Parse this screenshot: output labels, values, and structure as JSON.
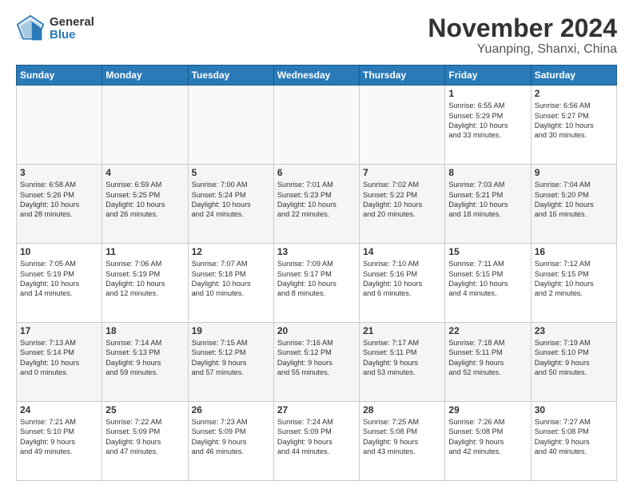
{
  "header": {
    "logo_general": "General",
    "logo_blue": "Blue",
    "title": "November 2024",
    "subtitle": "Yuanping, Shanxi, China"
  },
  "weekdays": [
    "Sunday",
    "Monday",
    "Tuesday",
    "Wednesday",
    "Thursday",
    "Friday",
    "Saturday"
  ],
  "weeks": [
    [
      {
        "day": "",
        "info": ""
      },
      {
        "day": "",
        "info": ""
      },
      {
        "day": "",
        "info": ""
      },
      {
        "day": "",
        "info": ""
      },
      {
        "day": "",
        "info": ""
      },
      {
        "day": "1",
        "info": "Sunrise: 6:55 AM\nSunset: 5:29 PM\nDaylight: 10 hours\nand 33 minutes."
      },
      {
        "day": "2",
        "info": "Sunrise: 6:56 AM\nSunset: 5:27 PM\nDaylight: 10 hours\nand 30 minutes."
      }
    ],
    [
      {
        "day": "3",
        "info": "Sunrise: 6:58 AM\nSunset: 5:26 PM\nDaylight: 10 hours\nand 28 minutes."
      },
      {
        "day": "4",
        "info": "Sunrise: 6:59 AM\nSunset: 5:25 PM\nDaylight: 10 hours\nand 26 minutes."
      },
      {
        "day": "5",
        "info": "Sunrise: 7:00 AM\nSunset: 5:24 PM\nDaylight: 10 hours\nand 24 minutes."
      },
      {
        "day": "6",
        "info": "Sunrise: 7:01 AM\nSunset: 5:23 PM\nDaylight: 10 hours\nand 22 minutes."
      },
      {
        "day": "7",
        "info": "Sunrise: 7:02 AM\nSunset: 5:22 PM\nDaylight: 10 hours\nand 20 minutes."
      },
      {
        "day": "8",
        "info": "Sunrise: 7:03 AM\nSunset: 5:21 PM\nDaylight: 10 hours\nand 18 minutes."
      },
      {
        "day": "9",
        "info": "Sunrise: 7:04 AM\nSunset: 5:20 PM\nDaylight: 10 hours\nand 16 minutes."
      }
    ],
    [
      {
        "day": "10",
        "info": "Sunrise: 7:05 AM\nSunset: 5:19 PM\nDaylight: 10 hours\nand 14 minutes."
      },
      {
        "day": "11",
        "info": "Sunrise: 7:06 AM\nSunset: 5:19 PM\nDaylight: 10 hours\nand 12 minutes."
      },
      {
        "day": "12",
        "info": "Sunrise: 7:07 AM\nSunset: 5:18 PM\nDaylight: 10 hours\nand 10 minutes."
      },
      {
        "day": "13",
        "info": "Sunrise: 7:09 AM\nSunset: 5:17 PM\nDaylight: 10 hours\nand 8 minutes."
      },
      {
        "day": "14",
        "info": "Sunrise: 7:10 AM\nSunset: 5:16 PM\nDaylight: 10 hours\nand 6 minutes."
      },
      {
        "day": "15",
        "info": "Sunrise: 7:11 AM\nSunset: 5:15 PM\nDaylight: 10 hours\nand 4 minutes."
      },
      {
        "day": "16",
        "info": "Sunrise: 7:12 AM\nSunset: 5:15 PM\nDaylight: 10 hours\nand 2 minutes."
      }
    ],
    [
      {
        "day": "17",
        "info": "Sunrise: 7:13 AM\nSunset: 5:14 PM\nDaylight: 10 hours\nand 0 minutes."
      },
      {
        "day": "18",
        "info": "Sunrise: 7:14 AM\nSunset: 5:13 PM\nDaylight: 9 hours\nand 59 minutes."
      },
      {
        "day": "19",
        "info": "Sunrise: 7:15 AM\nSunset: 5:12 PM\nDaylight: 9 hours\nand 57 minutes."
      },
      {
        "day": "20",
        "info": "Sunrise: 7:16 AM\nSunset: 5:12 PM\nDaylight: 9 hours\nand 55 minutes."
      },
      {
        "day": "21",
        "info": "Sunrise: 7:17 AM\nSunset: 5:11 PM\nDaylight: 9 hours\nand 53 minutes."
      },
      {
        "day": "22",
        "info": "Sunrise: 7:18 AM\nSunset: 5:11 PM\nDaylight: 9 hours\nand 52 minutes."
      },
      {
        "day": "23",
        "info": "Sunrise: 7:19 AM\nSunset: 5:10 PM\nDaylight: 9 hours\nand 50 minutes."
      }
    ],
    [
      {
        "day": "24",
        "info": "Sunrise: 7:21 AM\nSunset: 5:10 PM\nDaylight: 9 hours\nand 49 minutes."
      },
      {
        "day": "25",
        "info": "Sunrise: 7:22 AM\nSunset: 5:09 PM\nDaylight: 9 hours\nand 47 minutes."
      },
      {
        "day": "26",
        "info": "Sunrise: 7:23 AM\nSunset: 5:09 PM\nDaylight: 9 hours\nand 46 minutes."
      },
      {
        "day": "27",
        "info": "Sunrise: 7:24 AM\nSunset: 5:09 PM\nDaylight: 9 hours\nand 44 minutes."
      },
      {
        "day": "28",
        "info": "Sunrise: 7:25 AM\nSunset: 5:08 PM\nDaylight: 9 hours\nand 43 minutes."
      },
      {
        "day": "29",
        "info": "Sunrise: 7:26 AM\nSunset: 5:08 PM\nDaylight: 9 hours\nand 42 minutes."
      },
      {
        "day": "30",
        "info": "Sunrise: 7:27 AM\nSunset: 5:08 PM\nDaylight: 9 hours\nand 40 minutes."
      }
    ]
  ]
}
